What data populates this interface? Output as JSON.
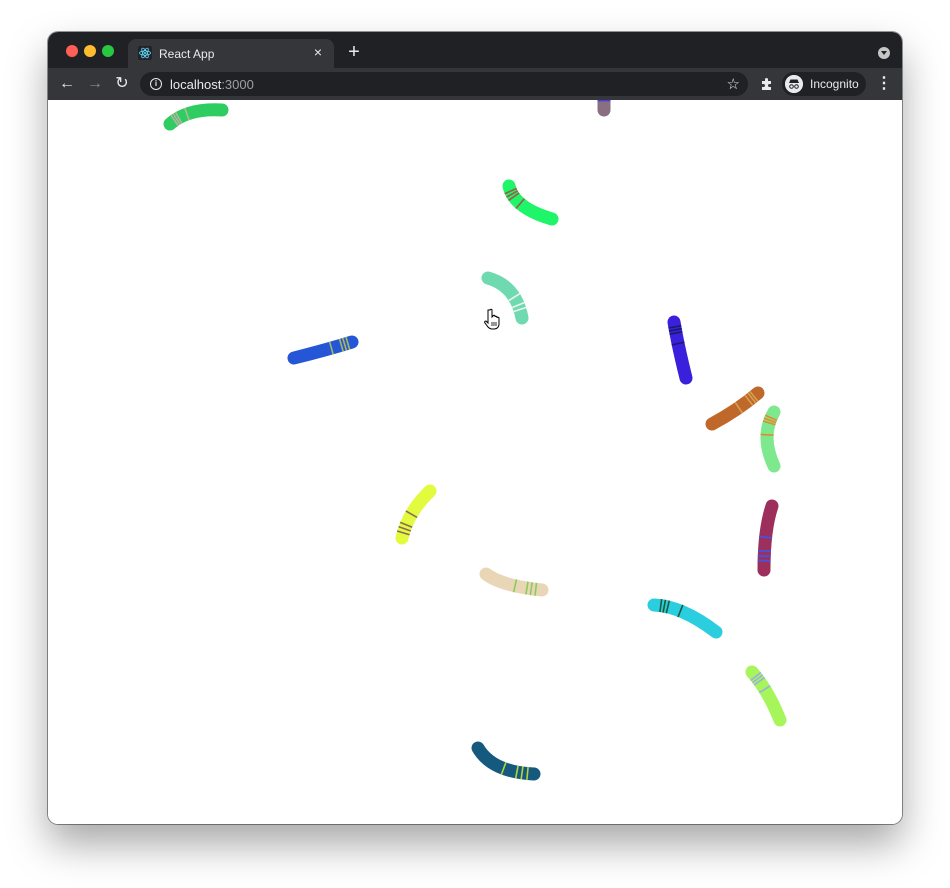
{
  "browser": {
    "tab": {
      "title": "React App",
      "favicon": "react-logo-icon"
    },
    "new_tab_label": "+",
    "close_tab_label": "×",
    "address": {
      "host": "localhost",
      "port": ":3000"
    },
    "profile_label": "Incognito",
    "icons": {
      "back": "←",
      "forward": "→",
      "reload": "↻",
      "info": "i",
      "star": "☆",
      "extensions": "✱",
      "menu": "⋮"
    }
  },
  "canvas": {
    "worms": [
      {
        "id": "worm-1",
        "color": "#2ecc61",
        "stripe": "#b5b5a0"
      },
      {
        "id": "worm-2",
        "color": "#8a6f80",
        "stripe": "#4a3fd8"
      },
      {
        "id": "worm-3",
        "color": "#1ef569",
        "stripe": "#a05a4a"
      },
      {
        "id": "worm-4",
        "color": "#6fd9b0",
        "stripe": "#e8f5ef"
      },
      {
        "id": "worm-5",
        "color": "#2456d6",
        "stripe": "#a8b85a"
      },
      {
        "id": "worm-6",
        "color": "#3a1fdc",
        "stripe": "#1a1a6a"
      },
      {
        "id": "worm-7",
        "color": "#c0682a",
        "stripe": "#d3a050"
      },
      {
        "id": "worm-8",
        "color": "#7ee88e",
        "stripe": "#e58a2a"
      },
      {
        "id": "worm-9",
        "color": "#e2fb3e",
        "stripe": "#8a6a5a"
      },
      {
        "id": "worm-10",
        "color": "#9c2f5c",
        "stripe": "#3a58ee"
      },
      {
        "id": "worm-11",
        "color": "#e8d6b6",
        "stripe": "#8acd5a"
      },
      {
        "id": "worm-12",
        "color": "#2bcede",
        "stripe": "#1a5a3a"
      },
      {
        "id": "worm-13",
        "color": "#a6f55a",
        "stripe": "#9ab0e0"
      },
      {
        "id": "worm-14",
        "color": "#15597e",
        "stripe": "#b6d43a"
      }
    ]
  }
}
